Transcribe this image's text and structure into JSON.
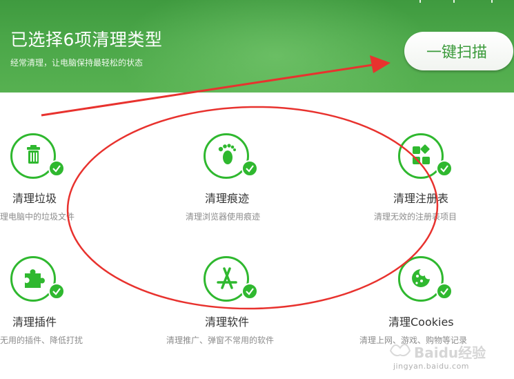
{
  "header": {
    "title": "已选择6项清理类型",
    "subtitle": "经常清理，让电脑保持最轻松的状态",
    "scan_button": "一键扫描"
  },
  "items": [
    {
      "icon": "trash-icon",
      "title": "清理垃圾",
      "desc": "理电脑中的垃圾文件",
      "checked": true
    },
    {
      "icon": "footprint-icon",
      "title": "清理痕迹",
      "desc": "清理浏览器使用痕迹",
      "checked": true
    },
    {
      "icon": "registry-icon",
      "title": "清理注册表",
      "desc": "清理无效的注册表项目",
      "checked": true
    },
    {
      "icon": "puzzle-icon",
      "title": "清理插件",
      "desc": "无用的插件、降低打扰",
      "checked": true
    },
    {
      "icon": "app-store-icon",
      "title": "清理软件",
      "desc": "清理推广、弹窗不常用的软件",
      "checked": true
    },
    {
      "icon": "cookie-icon",
      "title": "清理Cookies",
      "desc": "清理上网、游戏、购物等记录",
      "checked": true
    }
  ],
  "watermark": {
    "brand": "Baidu经验",
    "url": "jingyan.baidu.com"
  },
  "colors": {
    "header_green": "#4aa648",
    "accent_green": "#2fb82f",
    "annotation_red": "#e8322e"
  }
}
